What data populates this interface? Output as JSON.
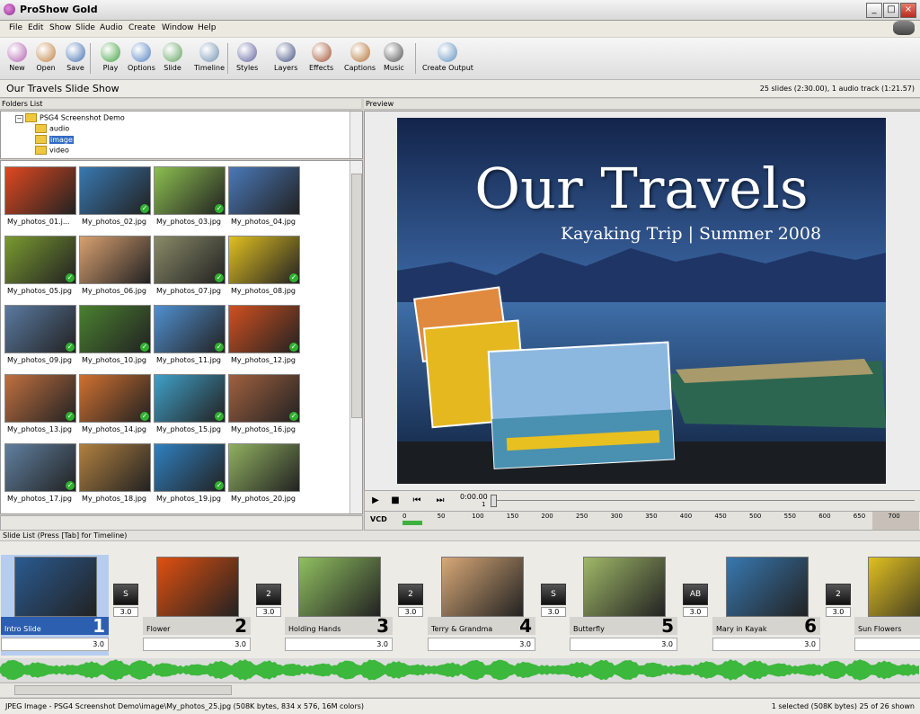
{
  "window": {
    "title": "ProShow Gold"
  },
  "menu": [
    "File",
    "Edit",
    "Show",
    "Slide",
    "Audio",
    "Create",
    "Window",
    "Help"
  ],
  "toolbar": [
    {
      "label": "New",
      "icon": "new-icon",
      "color": "#b060b0"
    },
    {
      "label": "Open",
      "icon": "open-icon",
      "color": "#c08040"
    },
    {
      "label": "Save",
      "icon": "save-icon",
      "color": "#4070b0"
    },
    {
      "label": "Play",
      "icon": "play-icon",
      "color": "#40a040"
    },
    {
      "label": "Options",
      "icon": "options-icon",
      "color": "#5080c0"
    },
    {
      "label": "Slide",
      "icon": "slide-icon",
      "color": "#60a060"
    },
    {
      "label": "Timeline",
      "icon": "timeline-icon",
      "color": "#7090b0"
    },
    {
      "label": "Styles",
      "icon": "styles-icon",
      "color": "#6060a0"
    },
    {
      "label": "Layers",
      "icon": "layers-icon",
      "color": "#405080"
    },
    {
      "label": "Effects",
      "icon": "effects-icon",
      "color": "#a05030"
    },
    {
      "label": "Captions",
      "icon": "captions-icon",
      "color": "#b07030"
    },
    {
      "label": "Music",
      "icon": "music-icon",
      "color": "#505050"
    },
    {
      "label": "Create Output",
      "icon": "create-output-icon",
      "color": "#6090c0"
    }
  ],
  "show": {
    "title": "Our Travels Slide Show",
    "info": "25 slides (2:30.00), 1 audio track (1:21.57)"
  },
  "folders": {
    "header": "Folders List",
    "root": "PSG4 Screenshot Demo",
    "items": [
      "audio",
      "image",
      "video"
    ],
    "selected": "image"
  },
  "photos": [
    {
      "name": "My_photos_01.j...",
      "color": "#e04820",
      "check": false
    },
    {
      "name": "My_photos_02.jpg",
      "color": "#3878b0",
      "check": true
    },
    {
      "name": "My_photos_03.jpg",
      "color": "#8cbf50",
      "check": true
    },
    {
      "name": "My_photos_04.jpg",
      "color": "#4a78b8",
      "check": false
    },
    {
      "name": "My_photos_05.jpg",
      "color": "#7a9a30",
      "check": true
    },
    {
      "name": "My_photos_06.jpg",
      "color": "#d8a070",
      "check": false
    },
    {
      "name": "My_photos_07.jpg",
      "color": "#8a8a68",
      "check": true
    },
    {
      "name": "My_photos_08.jpg",
      "color": "#e0c020",
      "check": true
    },
    {
      "name": "My_photos_09.jpg",
      "color": "#5a7aa0",
      "check": true
    },
    {
      "name": "My_photos_10.jpg",
      "color": "#4a8030",
      "check": true
    },
    {
      "name": "My_photos_11.jpg",
      "color": "#5090d0",
      "check": true
    },
    {
      "name": "My_photos_12.jpg",
      "color": "#d05020",
      "check": true
    },
    {
      "name": "My_photos_13.jpg",
      "color": "#c07040",
      "check": true
    },
    {
      "name": "My_photos_14.jpg",
      "color": "#d07030",
      "check": true
    },
    {
      "name": "My_photos_15.jpg",
      "color": "#40a0c8",
      "check": true
    },
    {
      "name": "My_photos_16.jpg",
      "color": "#a06040",
      "check": true
    },
    {
      "name": "My_photos_17.jpg",
      "color": "#6080a0",
      "check": true
    },
    {
      "name": "My_photos_18.jpg",
      "color": "#b08040",
      "check": false
    },
    {
      "name": "My_photos_19.jpg",
      "color": "#3080c0",
      "check": true
    },
    {
      "name": "My_photos_20.jpg",
      "color": "#90b060",
      "check": false
    }
  ],
  "preview": {
    "header": "Preview",
    "title": "Our Travels",
    "subtitle": "Kayaking Trip | Summer 2008",
    "time": "0:00.00",
    "time_sub": "1",
    "format": "VCD",
    "ruler": [
      "0",
      "50",
      "100",
      "150",
      "200",
      "250",
      "300",
      "350",
      "400",
      "450",
      "500",
      "550",
      "600",
      "650",
      "700"
    ]
  },
  "slide_list": {
    "header": "Slide List (Press [Tab] for Timeline)",
    "slides": [
      {
        "name": "Intro Slide",
        "num": "1",
        "dur": "3.0",
        "color": "#2a5a90",
        "selected": true
      },
      {
        "name": "Flower",
        "num": "2",
        "dur": "3.0",
        "color": "#e05010",
        "selected": false
      },
      {
        "name": "Holding Hands",
        "num": "3",
        "dur": "3.0",
        "color": "#90c060",
        "selected": false
      },
      {
        "name": "Terry & Grandma",
        "num": "4",
        "dur": "3.0",
        "color": "#d8a878",
        "selected": false
      },
      {
        "name": "Butterfly",
        "num": "5",
        "dur": "3.0",
        "color": "#a0b868",
        "selected": false
      },
      {
        "name": "Mary in Kayak",
        "num": "6",
        "dur": "3.0",
        "color": "#3878b0",
        "selected": false
      },
      {
        "name": "Sun Flowers",
        "num": "",
        "dur": "",
        "color": "#e0c020",
        "selected": false
      }
    ],
    "transitions": [
      {
        "glyph": "S",
        "dur": "3.0"
      },
      {
        "glyph": "2",
        "dur": "3.0"
      },
      {
        "glyph": "2",
        "dur": "3.0"
      },
      {
        "glyph": "S",
        "dur": "3.0"
      },
      {
        "glyph": "AB",
        "dur": "3.0"
      },
      {
        "glyph": "2",
        "dur": "3.0"
      }
    ]
  },
  "status": {
    "left": "JPEG Image - PSG4 Screenshot Demo\\image\\My_photos_25.jpg  (508K bytes, 834 x 576, 16M colors)",
    "right": "1 selected (508K bytes) 25 of 26 shown"
  }
}
